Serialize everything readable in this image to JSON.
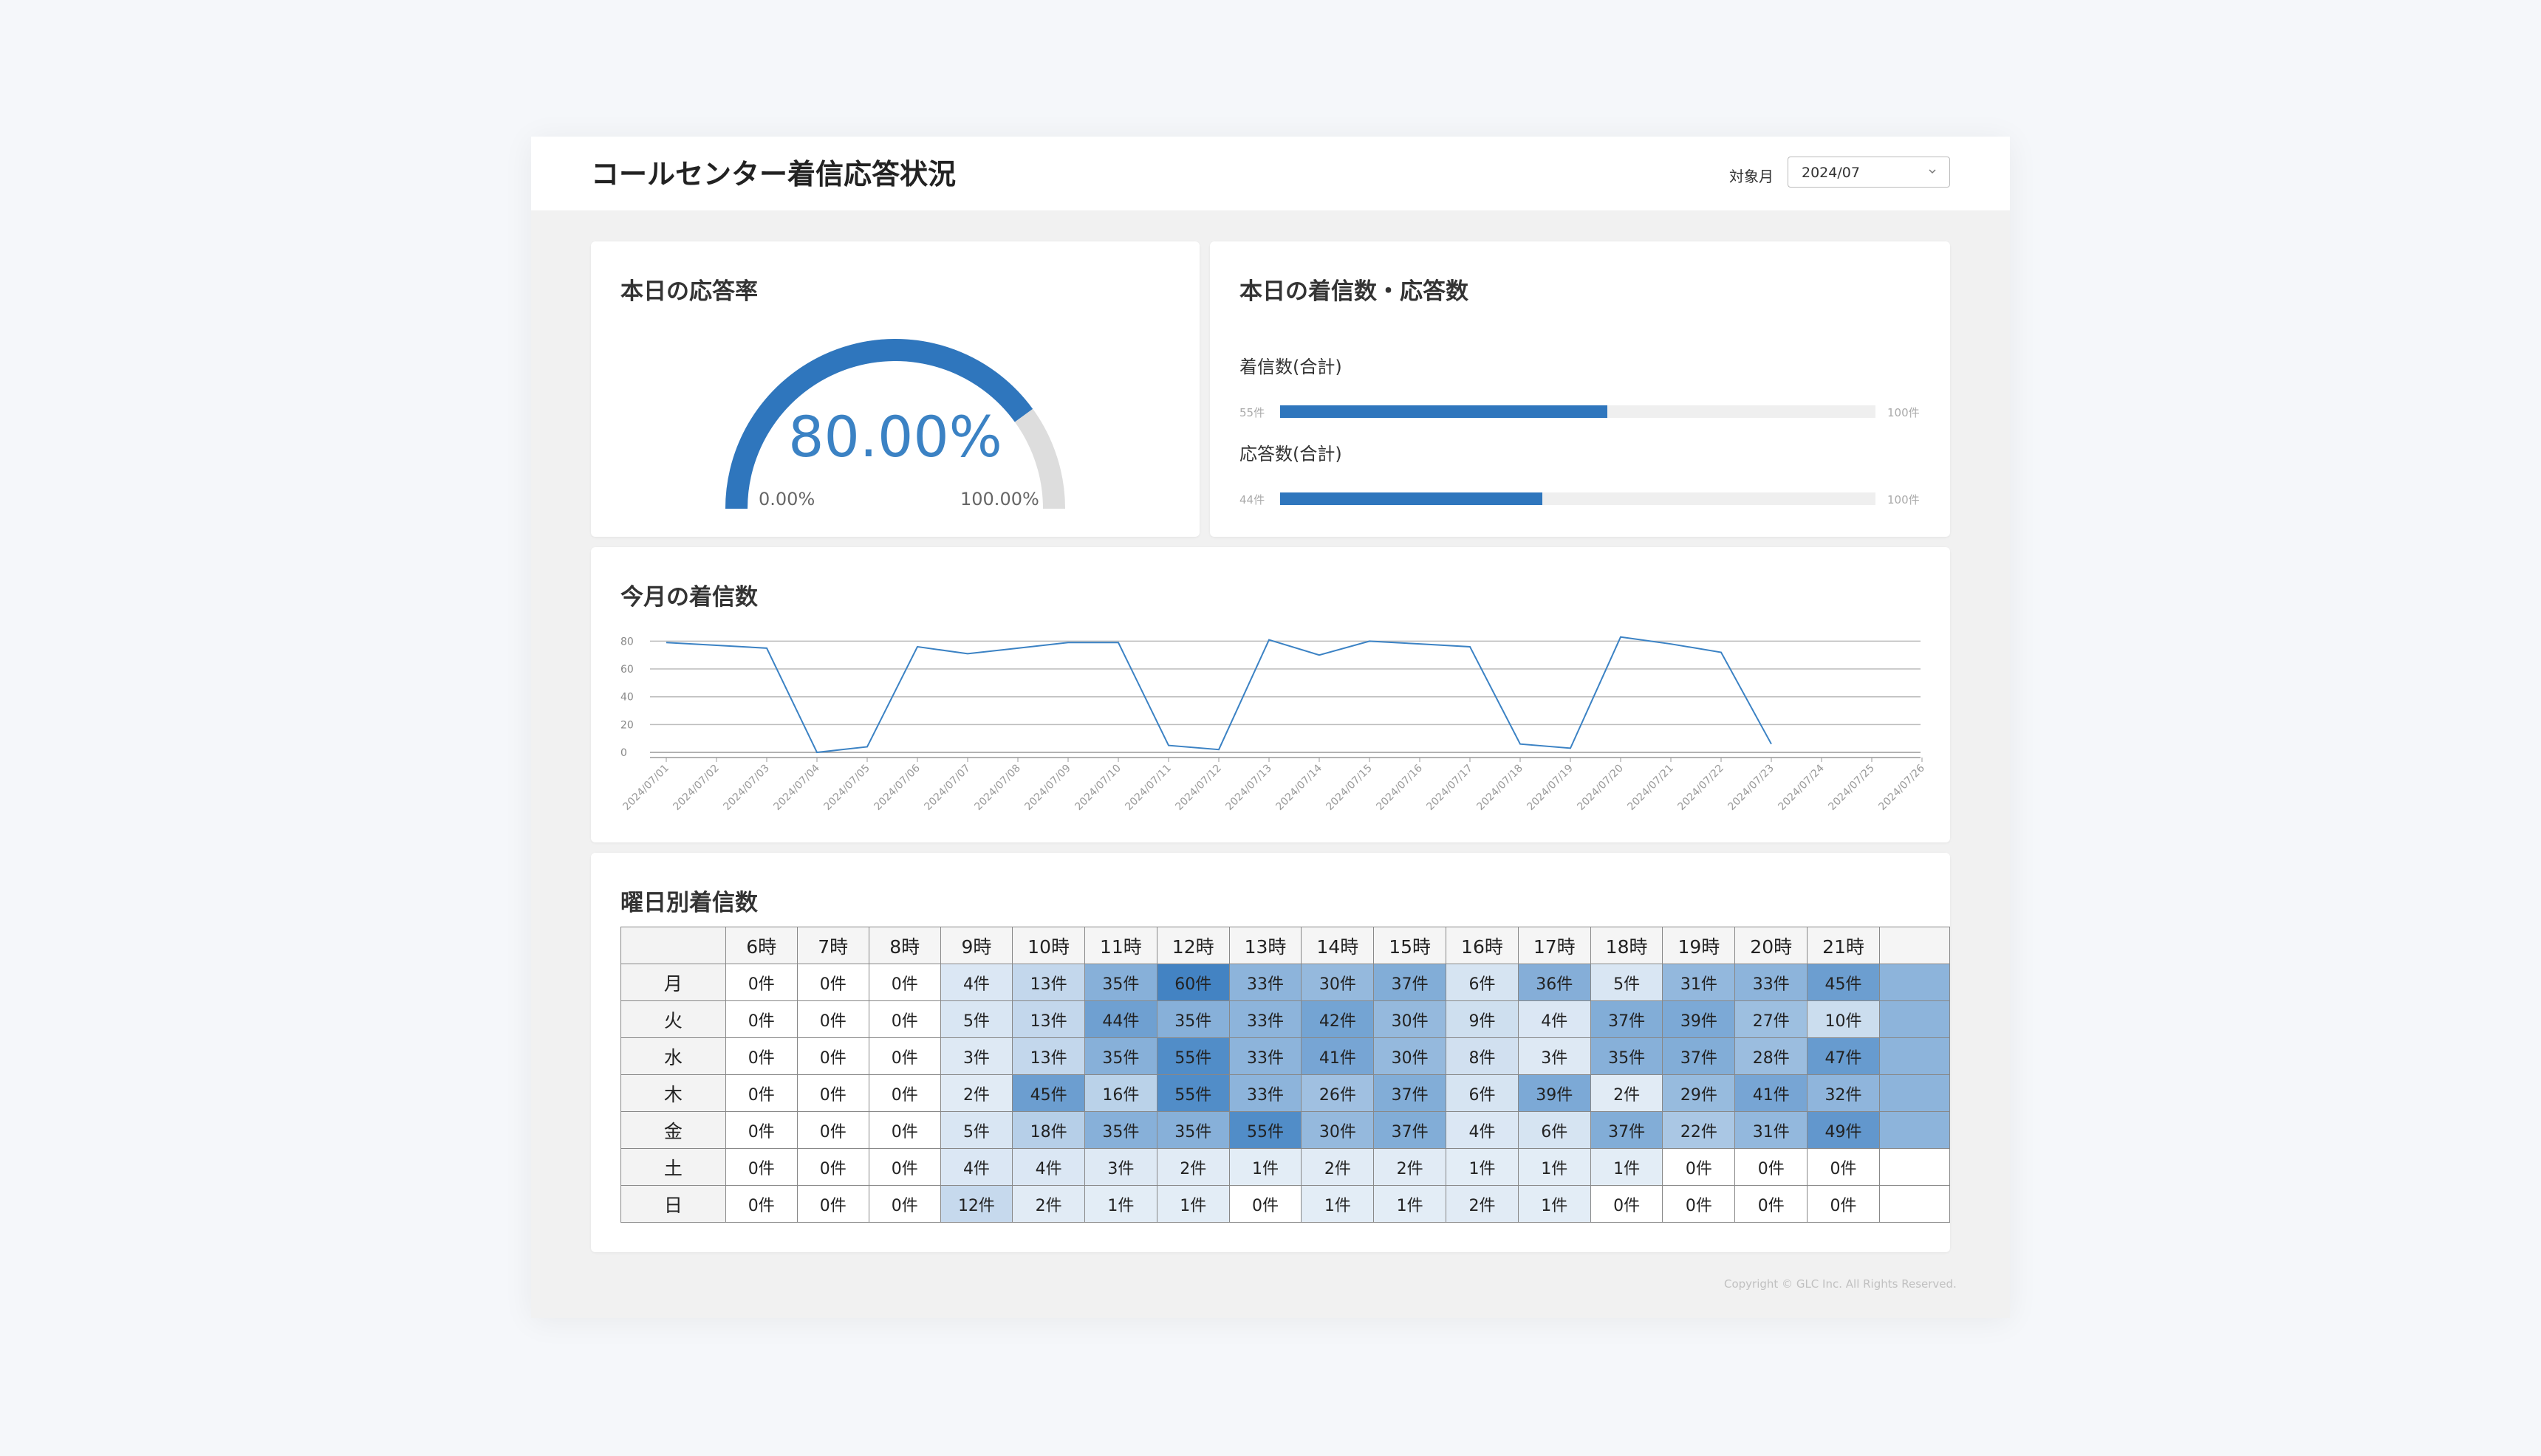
{
  "header": {
    "title": "コールセンター着信応答状況",
    "month_label": "対象月",
    "month_value": "2024/07"
  },
  "response_rate": {
    "title": "本日の応答率",
    "value": "80.00%",
    "fraction": 0.8,
    "min_label": "0.00%",
    "max_label": "100.00%",
    "colors": {
      "fill": "#2f76bd",
      "track": "#dddddd"
    }
  },
  "counts": {
    "title": "本日の着信数・応答数",
    "bars": [
      {
        "label": "着信数(合計)",
        "value_label": "55件",
        "max_label": "100件",
        "fraction": 0.55
      },
      {
        "label": "応答数(合計)",
        "value_label": "44件",
        "max_label": "100件",
        "fraction": 0.44
      }
    ]
  },
  "monthly": {
    "title": "今月の着信数"
  },
  "chart_data": {
    "type": "line",
    "title": "今月の着信数",
    "xlabel": "",
    "ylabel": "",
    "x": [
      "2024/07/01",
      "2024/07/02",
      "2024/07/03",
      "2024/07/04",
      "2024/07/05",
      "2024/07/06",
      "2024/07/07",
      "2024/07/08",
      "2024/07/09",
      "2024/07/10",
      "2024/07/11",
      "2024/07/12",
      "2024/07/13",
      "2024/07/14",
      "2024/07/15",
      "2024/07/16",
      "2024/07/17",
      "2024/07/18",
      "2024/07/19",
      "2024/07/20",
      "2024/07/21",
      "2024/07/22",
      "2024/07/23",
      "2024/07/24",
      "2024/07/25",
      "2024/07/26"
    ],
    "series": [
      {
        "values": [
          79,
          77,
          75,
          0,
          4,
          76,
          71,
          75,
          79,
          79,
          5,
          2,
          81,
          70,
          80,
          78,
          76,
          6,
          3,
          83,
          78,
          72,
          6
        ]
      }
    ],
    "y_ticks": [
      0,
      20,
      40,
      60,
      80
    ],
    "ylim": [
      0,
      85
    ],
    "grid": true,
    "color": "#3b82c4"
  },
  "heatmap": {
    "title": "曜日別着信数",
    "hours": [
      "6時",
      "7時",
      "8時",
      "9時",
      "10時",
      "11時",
      "12時",
      "13時",
      "14時",
      "15時",
      "16時",
      "17時",
      "18時",
      "19時",
      "20時",
      "21時"
    ],
    "rows": [
      {
        "day": "月",
        "cells": [
          "0件",
          "0件",
          "0件",
          "4件",
          "13件",
          "35件",
          "60件",
          "33件",
          "30件",
          "37件",
          "6件",
          "36件",
          "5件",
          "31件",
          "33件",
          "45件"
        ]
      },
      {
        "day": "火",
        "cells": [
          "0件",
          "0件",
          "0件",
          "5件",
          "13件",
          "44件",
          "35件",
          "33件",
          "42件",
          "30件",
          "9件",
          "4件",
          "37件",
          "39件",
          "27件",
          "10件"
        ]
      },
      {
        "day": "水",
        "cells": [
          "0件",
          "0件",
          "0件",
          "3件",
          "13件",
          "35件",
          "55件",
          "33件",
          "41件",
          "30件",
          "8件",
          "3件",
          "35件",
          "37件",
          "28件",
          "47件"
        ]
      },
      {
        "day": "木",
        "cells": [
          "0件",
          "0件",
          "0件",
          "2件",
          "45件",
          "16件",
          "55件",
          "33件",
          "26件",
          "37件",
          "6件",
          "39件",
          "2件",
          "29件",
          "41件",
          "32件"
        ]
      },
      {
        "day": "金",
        "cells": [
          "0件",
          "0件",
          "0件",
          "5件",
          "18件",
          "35件",
          "35件",
          "55件",
          "30件",
          "37件",
          "4件",
          "6件",
          "37件",
          "22件",
          "31件",
          "49件"
        ]
      },
      {
        "day": "土",
        "cells": [
          "0件",
          "0件",
          "0件",
          "4件",
          "4件",
          "3件",
          "2件",
          "1件",
          "2件",
          "2件",
          "1件",
          "1件",
          "1件",
          "0件",
          "0件",
          "0件"
        ]
      },
      {
        "day": "日",
        "cells": [
          "0件",
          "0件",
          "0件",
          "12件",
          "2件",
          "1件",
          "1件",
          "0件",
          "1件",
          "1件",
          "2件",
          "1件",
          "0件",
          "0件",
          "0件",
          "0件"
        ]
      }
    ],
    "color_max": 60,
    "base_color": "#2f76bd"
  },
  "footer": {
    "copyright": "Copyright © GLC Inc. All Rights Reserved."
  }
}
